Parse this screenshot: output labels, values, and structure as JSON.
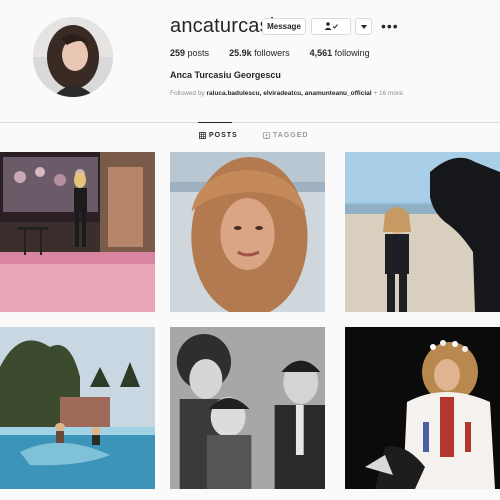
{
  "profile": {
    "username": "ancaturcasiu",
    "message_label": "Message",
    "followers_icon": "person-check-icon",
    "more_icon": "chevron-down-icon",
    "options_icon": "three-dots-icon",
    "options_glyph": "•••",
    "posts_count": "259",
    "posts_label": "posts",
    "followers_count": "25.9k",
    "followers_label": "followers",
    "following_count": "4,561",
    "following_label": "following",
    "full_name": "Anca Turcasiu Georgescu",
    "followed_prefix": "Followed by",
    "followed_names": "raluca.badulescu, elviradeatcu, anamunteanu_official",
    "followed_more": "+ 16 more"
  },
  "tabs": [
    {
      "label": "POSTS",
      "icon": "grid-icon",
      "active": true
    },
    {
      "label": "TAGGED",
      "icon": "tag-icon",
      "active": false
    }
  ],
  "posts": [
    {
      "subject": "stage-performance"
    },
    {
      "subject": "selfie-beach"
    },
    {
      "subject": "horse-beach"
    },
    {
      "subject": "pool"
    },
    {
      "subject": "vintage-family-photo"
    },
    {
      "subject": "night-flower-crown"
    }
  ]
}
